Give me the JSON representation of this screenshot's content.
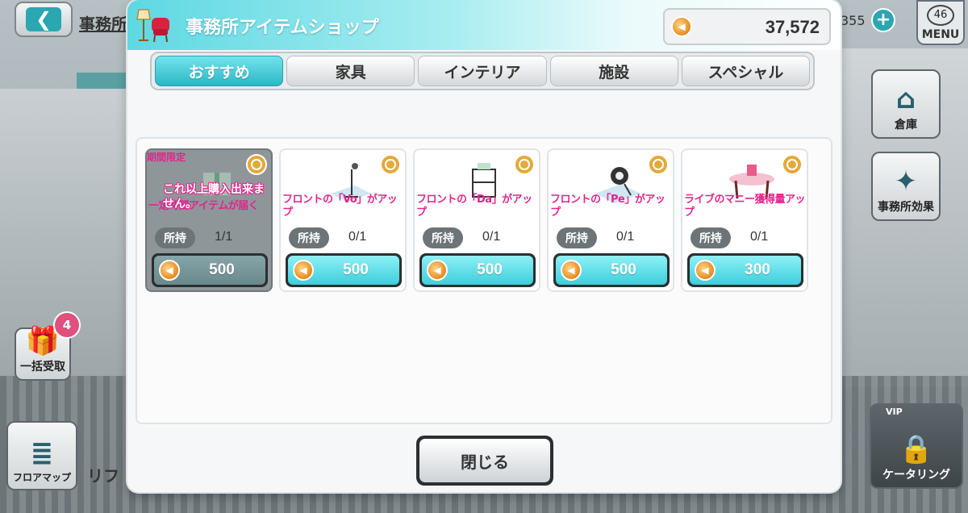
{
  "background": {
    "title": "事務所",
    "count": "355",
    "menu_level": "46",
    "menu_label": "MENU",
    "gift_badge": "4",
    "gift_label": "一括受取",
    "floor_label": "フロアマップ",
    "lift_label": "リフ",
    "storage_label": "倉庫",
    "effect_label": "事務所効果",
    "catering_label": "ケータリング",
    "vip_label": "VIP"
  },
  "modal": {
    "title": "事務所アイテムショップ",
    "coins": "37,572",
    "close_label": "閉じる"
  },
  "tabs": [
    {
      "label": "おすすめ",
      "active": true
    },
    {
      "label": "家具",
      "active": false
    },
    {
      "label": "インテリア",
      "active": false
    },
    {
      "label": "施設",
      "active": false
    },
    {
      "label": "スペシャル",
      "active": false
    }
  ],
  "items": [
    {
      "limited": "期間限定",
      "sold_message": "これ以上購入出来ません。",
      "description": "一定時間アイテムが届く",
      "own_label": "所持",
      "own_value": "1/1",
      "price": "500",
      "sold_out": true,
      "icon": "gift-box-icon"
    },
    {
      "description": "フロントの「Vo」がアップ",
      "own_label": "所持",
      "own_value": "0/1",
      "price": "500",
      "sold_out": false,
      "icon": "microphone-stand-icon"
    },
    {
      "description": "フロントの「Da」がアップ",
      "own_label": "所持",
      "own_value": "0/1",
      "price": "500",
      "sold_out": false,
      "icon": "shelf-icon"
    },
    {
      "description": "フロントの「Pe」がアップ",
      "own_label": "所持",
      "own_value": "0/1",
      "price": "500",
      "sold_out": false,
      "icon": "spotlight-icon"
    },
    {
      "description": "ライブのマニー獲得量アップ",
      "own_label": "所持",
      "own_value": "0/1",
      "price": "300",
      "sold_out": false,
      "icon": "side-table-icon"
    }
  ],
  "colors": {
    "accent": "#2bb7c5",
    "pink_text": "#e0268c",
    "coin": "#e68a1c"
  }
}
